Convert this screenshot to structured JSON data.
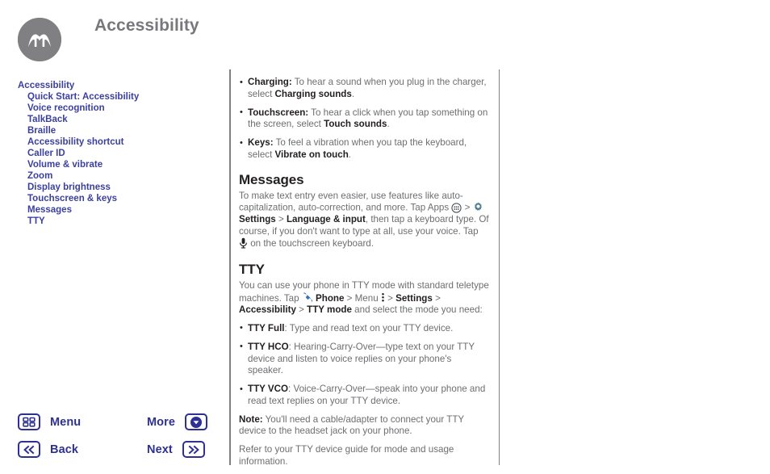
{
  "header": {
    "title": "Accessibility",
    "logo_icon": "motorola-logo-icon"
  },
  "sidebar": {
    "items": [
      {
        "label": "Accessibility",
        "level": "top"
      },
      {
        "label": "Quick Start: Accessibility",
        "level": "sub"
      },
      {
        "label": "Voice recognition",
        "level": "sub"
      },
      {
        "label": "TalkBack",
        "level": "sub"
      },
      {
        "label": "Braille",
        "level": "sub"
      },
      {
        "label": "Accessibility shortcut",
        "level": "sub"
      },
      {
        "label": "Caller ID",
        "level": "sub"
      },
      {
        "label": "Volume & vibrate",
        "level": "sub"
      },
      {
        "label": "Zoom",
        "level": "sub"
      },
      {
        "label": "Display brightness",
        "level": "sub"
      },
      {
        "label": "Touchscreen & keys",
        "level": "sub"
      },
      {
        "label": "Messages",
        "level": "sub"
      },
      {
        "label": "TTY",
        "level": "sub"
      }
    ]
  },
  "content": {
    "top_bullets": [
      {
        "lead": "Charging:",
        "text_1": " To hear a sound when you plug in the charger, select ",
        "bold_2": "Charging sounds",
        "text_3": "."
      },
      {
        "lead": "Touchscreen:",
        "text_1": " To hear a click when you tap something on the screen, select ",
        "bold_2": "Touch sounds",
        "text_3": "."
      },
      {
        "lead": "Keys:",
        "text_1": " To feel a vibration when you tap the keyboard, select ",
        "bold_2": "Vibrate on touch",
        "text_3": "."
      }
    ],
    "messages": {
      "heading": "Messages",
      "p1_a": "To make text entry even easier, use features like auto-capitalization, auto-correction, and more. Tap Apps ",
      "apps_icon": "apps-grid-icon",
      "p1_b": " > ",
      "gear_icon": "settings-gear-icon",
      "p1_bold_settings": "Settings",
      "p1_c": " > ",
      "p1_bold_language": "Language & input",
      "p1_d": ", then tap a keyboard type. Of course, if you don't want to type at all, use your voice. Tap ",
      "mic_icon": "microphone-icon",
      "p1_e": " on the touchscreen keyboard."
    },
    "tty": {
      "heading": "TTY",
      "p1_a": "You can use your phone in TTY mode with standard teletype machines. Tap ",
      "phone_icon": "phone-handset-icon",
      "p1_bold_phone": "Phone",
      "p1_b": " > Menu ",
      "kebab_icon": "menu-kebab-icon",
      "p1_c": " > ",
      "p1_bold_settings": "Settings",
      "p1_d": " > ",
      "p1_bold_accessibility": "Accessibility",
      "p1_e": " > ",
      "p1_bold_ttymode": "TTY mode",
      "p1_f": " and select the mode you need:",
      "bullets": [
        {
          "lead": "TTY Full",
          "text": ": Type and read text on your TTY device."
        },
        {
          "lead": "TTY HCO",
          "text": ": Hearing-Carry-Over—type text on your TTY device and listen to voice replies on your phone's speaker."
        },
        {
          "lead": "TTY VCO",
          "text": ": Voice-Carry-Over—speak into your phone and read text replies on your TTY device."
        }
      ],
      "note_lead": "Note:",
      "note_text": " You'll need a cable/adapter to connect your TTY device to the headset jack on your phone.",
      "refer_text": "Refer to your TTY device guide for mode and usage information."
    }
  },
  "bottom_nav": {
    "menu_label": "Menu",
    "menu_icon": "grid-menu-icon",
    "back_label": "Back",
    "back_icon": "double-chevron-left-icon",
    "more_label": "More",
    "more_icon": "chevron-down-circle-icon",
    "next_label": "Next",
    "next_icon": "double-chevron-right-icon"
  },
  "colors": {
    "link_blue": "#3a3fa0",
    "nav_blue": "#2e3192",
    "body_gray": "#6d6e71",
    "heading_dark": "#231f20",
    "title_gray": "#77787b",
    "logo_gray": "#808083",
    "gear_teal": "#4f7f8f"
  }
}
